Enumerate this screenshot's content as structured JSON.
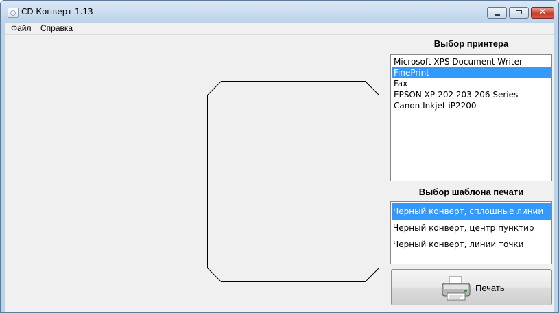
{
  "window": {
    "title": "CD Конверт 1.13"
  },
  "menu": {
    "file": "Файл",
    "help": "Справка"
  },
  "printer_section": {
    "title": "Выбор принтера",
    "items": [
      "Microsoft XPS Document Writer",
      "FinePrint",
      "Fax",
      "EPSON XP-202 203 206 Series",
      "Canon Inkjet iP2200"
    ],
    "selected": "FinePrint"
  },
  "template_section": {
    "title": "Выбор шаблона печати",
    "items": [
      "Черный конверт, сплошные линии",
      "Черный конверт, центр пунктир",
      "Черный конверт, линии точки"
    ],
    "selected": "Черный конверт, сплошные линии"
  },
  "print_button": {
    "label": "Печать",
    "icon": "printer-icon"
  },
  "colors": {
    "selection": "#3399ff",
    "client_bg": "#f0f0f0",
    "close_button": "#c73b24"
  }
}
